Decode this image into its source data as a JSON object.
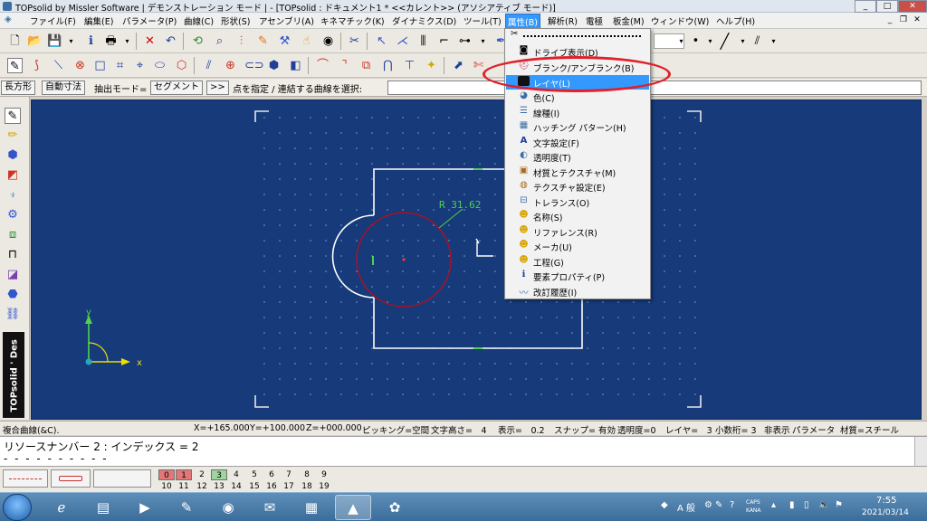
{
  "window": {
    "title": "TOPsolid by Missler Software | デモンストレーション モード | - [TOPsolid : ドキュメント1 *  <<カレント>> (アソシアティブ モード)]",
    "minimize": "_",
    "maximize": "□",
    "close": "✕"
  },
  "menubar": {
    "items": [
      "ファイル(F)",
      "編集(E)",
      "パラメータ(P)",
      "曲線(C)",
      "形状(S)",
      "アセンブリ(A)",
      "キネマチック(K)",
      "ダイナミクス(D)",
      "ツール(T)",
      "属性(B)",
      "解析(R)",
      "電極",
      "板金(M)",
      "ウィンドウ(W)",
      "ヘルプ(H)"
    ],
    "active_index": 9,
    "mdi_min": "_",
    "mdi_restore": "❐",
    "mdi_close": "✕"
  },
  "commandline": {
    "btn_rect": "長方形",
    "btn_auto_dim": "自動寸法",
    "extract_mode_label": "抽出モード=",
    "extract_mode_value": "セグメント",
    "btn_next": ">>",
    "prompt": "点を指定 / 連結する曲線を選択:"
  },
  "brand": "TOPsolid ' Des",
  "canvas": {
    "dimension_label": "R 31.62",
    "axis_x": "x",
    "axis_y": "y"
  },
  "statusbar": {
    "left": "複合曲線(&C).",
    "x": "X=+165.000",
    "y": "Y=+100.000",
    "z": "Z=+000.000",
    "picking": "ピッキング=空間",
    "text_height": "文字高さ=　4",
    "display": "表示=　0.2",
    "snap": "スナップ= 有効",
    "transparency": "透明度=0",
    "layer": "レイヤ=　3",
    "decimals": "小数桁= 3",
    "hidden": "非表示",
    "params": "パラメータ",
    "material": "材質=スチール"
  },
  "message": {
    "line1": "リソースナンバー 2 : インデックス = 2",
    "line2": "- - - - - - - - - -"
  },
  "layers": {
    "top": [
      "0",
      "1",
      "2",
      "3",
      "4",
      "5",
      "6",
      "7",
      "8",
      "9"
    ],
    "bottom": [
      "10",
      "11",
      "12",
      "13",
      "14",
      "15",
      "16",
      "17",
      "18",
      "19"
    ]
  },
  "dropdown": {
    "items": [
      {
        "icon": "drive-icon",
        "glyph": "◙",
        "label": "ドライブ表示(D)"
      },
      {
        "icon": "blank-icon",
        "glyph": "⛑",
        "label": "ブランク/アンブランク(B)"
      },
      {
        "icon": "layer-icon",
        "glyph": "■",
        "label": "レイヤ(L)"
      },
      {
        "icon": "color-icon",
        "glyph": "◕",
        "label": "色(C)"
      },
      {
        "icon": "linetype-icon",
        "glyph": "☰",
        "label": "線種(I)"
      },
      {
        "icon": "hatch-icon",
        "glyph": "▦",
        "label": "ハッチング パターン(H)"
      },
      {
        "icon": "text-icon",
        "glyph": "A",
        "label": "文字設定(F)"
      },
      {
        "icon": "transparency-icon",
        "glyph": "◐",
        "label": "透明度(T)"
      },
      {
        "icon": "material-icon",
        "glyph": "▣",
        "label": "材質とテクスチャ(M)"
      },
      {
        "icon": "texture-icon",
        "glyph": "◍",
        "label": "テクスチャ設定(E)"
      },
      {
        "icon": "tolerance-icon",
        "glyph": "⊟",
        "label": "トレランス(O)"
      },
      {
        "icon": "name-icon",
        "glyph": "☻",
        "label": "名称(S)"
      },
      {
        "icon": "reference-icon",
        "glyph": "☻",
        "label": "リファレンス(R)"
      },
      {
        "icon": "maker-icon",
        "glyph": "☻",
        "label": "メーカ(U)"
      },
      {
        "icon": "process-icon",
        "glyph": "☻",
        "label": "工程(G)"
      },
      {
        "icon": "info-icon",
        "glyph": "ℹ",
        "label": "要素プロパティ(P)"
      },
      {
        "icon": "revision-icon",
        "glyph": "〰",
        "label": "改訂履歴(I)"
      }
    ],
    "highlight_index": 2,
    "annotation_color": "#e0202a"
  },
  "taskbar": {
    "ime": "A 般",
    "caps": "CAPS",
    "kana": "KANA",
    "time": "7:55",
    "date": "2021/03/14"
  },
  "colors": {
    "canvas_bg": "#163a7a",
    "menu_highlight": "#3399ff",
    "geometry_white": "#ffffff",
    "circle_red": "#b01020",
    "dimension_green": "#4fd14f"
  }
}
